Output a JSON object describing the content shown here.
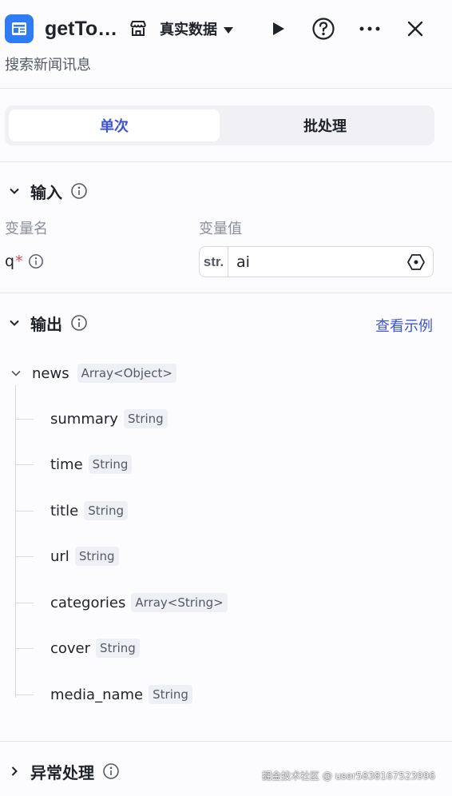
{
  "header": {
    "title": "getTo…",
    "data_mode": "真实数据",
    "subtitle": "搜索新闻讯息"
  },
  "tabs": [
    {
      "label": "单次",
      "active": true
    },
    {
      "label": "批处理",
      "active": false
    }
  ],
  "input": {
    "title": "输入",
    "col_name": "变量名",
    "col_value": "变量值",
    "var_name": "q",
    "required_mark": "*",
    "type_tag": "str.",
    "value": "ai"
  },
  "output": {
    "title": "输出",
    "example_link": "查看示例",
    "root": {
      "name": "news",
      "type": "Array<Object>"
    },
    "fields": [
      {
        "name": "summary",
        "type": "String"
      },
      {
        "name": "time",
        "type": "String"
      },
      {
        "name": "title",
        "type": "String"
      },
      {
        "name": "url",
        "type": "String"
      },
      {
        "name": "categories",
        "type": "Array<String>"
      },
      {
        "name": "cover",
        "type": "String"
      },
      {
        "name": "media_name",
        "type": "String"
      }
    ]
  },
  "exception": {
    "title": "异常处理"
  },
  "watermark": "掘金技术社区 @ user5838167523996",
  "icons": [
    "app-icon",
    "store-icon",
    "play-icon",
    "help-icon",
    "more-icon",
    "close-icon",
    "chevron-down-icon",
    "chevron-right-icon",
    "info-icon",
    "variable-icon"
  ],
  "colors": {
    "accent": "#3d55d8",
    "app_icon": "#2f7cf6",
    "required": "#e5484d"
  }
}
